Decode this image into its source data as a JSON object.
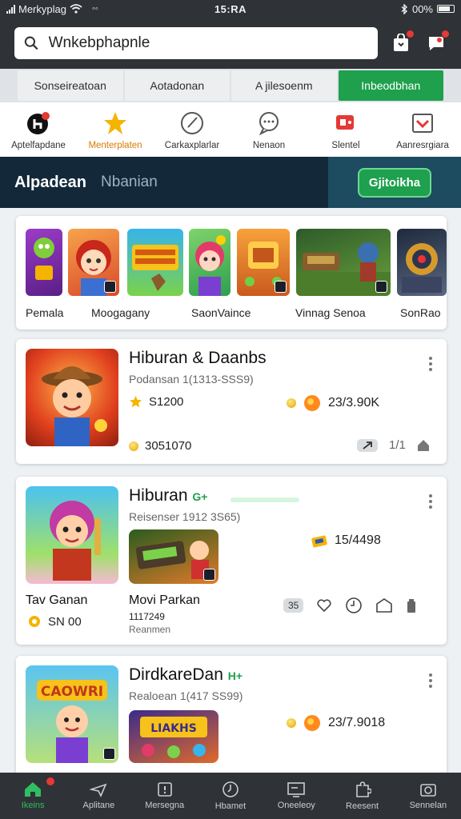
{
  "status_bar": {
    "carrier": "Merkyplag",
    "time": "15:RA",
    "battery": "00%"
  },
  "search": {
    "value": "Wnkebphapnle"
  },
  "tabs": [
    {
      "label": "Sonseireatoan",
      "active": false
    },
    {
      "label": "Aotadonan",
      "active": false
    },
    {
      "label": "A jilesoenm",
      "active": false
    },
    {
      "label": "Inbeodbhan",
      "active": true
    }
  ],
  "categories": [
    {
      "label": "Aptelfapdane",
      "icon": "app-badge-icon"
    },
    {
      "label": "Menterplaten",
      "icon": "star-icon"
    },
    {
      "label": "Carkaxplarlar",
      "icon": "compass-icon"
    },
    {
      "label": "Nenaon",
      "icon": "chat-bubble-icon"
    },
    {
      "label": "Slentel",
      "icon": "video-icon"
    },
    {
      "label": "Aanresrgiara",
      "icon": "inbox-check-icon"
    }
  ],
  "section": {
    "title": "Alpadean",
    "subtitle": "Nbanian",
    "button": "Gjitoikha"
  },
  "featured_strip": {
    "labels": [
      "Pemala",
      "Moogagany",
      "SaonVaince",
      "Vinnag Senoa",
      "SonRao"
    ]
  },
  "cards": [
    {
      "title": "Hiburan & Daanbs",
      "subtitle": "Podansan 1(1313-SSS9)",
      "rating": "S1200",
      "count": "23/3.90K",
      "coins": "3051070",
      "pill": "1/1"
    },
    {
      "title": "Hiburan",
      "tag": "G+",
      "subtitle": "Reisenser 1912 3S65)",
      "score": "15/4498",
      "left_name": "Tav Ganan",
      "left_value": "SN 00",
      "mid_name": "Movi Parkan",
      "mid_code": "1117249",
      "mid_label": "Reanmen",
      "pill": "35"
    },
    {
      "title": "DirdkareDan",
      "tag": "H+",
      "subtitle": "Realoean 1(417 SS99)",
      "count": "23/7.9018",
      "art_text_1": "CAOWRI",
      "art_text_2": "LIAKHS"
    }
  ],
  "bottom_nav": [
    {
      "label": "Ikeins",
      "icon": "home-icon",
      "active": true
    },
    {
      "label": "Aplitane",
      "icon": "plane-icon",
      "active": false
    },
    {
      "label": "Mersegna",
      "icon": "alert-box-icon",
      "active": false
    },
    {
      "label": "Hbamet",
      "icon": "clock-icon",
      "active": false
    },
    {
      "label": "Oneeleoy",
      "icon": "screen-icon",
      "active": false
    },
    {
      "label": "Reesent",
      "icon": "puzzle-icon",
      "active": false
    },
    {
      "label": "Sennelan",
      "icon": "camera-icon",
      "active": false
    }
  ],
  "colors": {
    "accent": "#1ea04d",
    "header": "#2f3236",
    "section_bg": "#13293a",
    "notification": "#e53935"
  }
}
